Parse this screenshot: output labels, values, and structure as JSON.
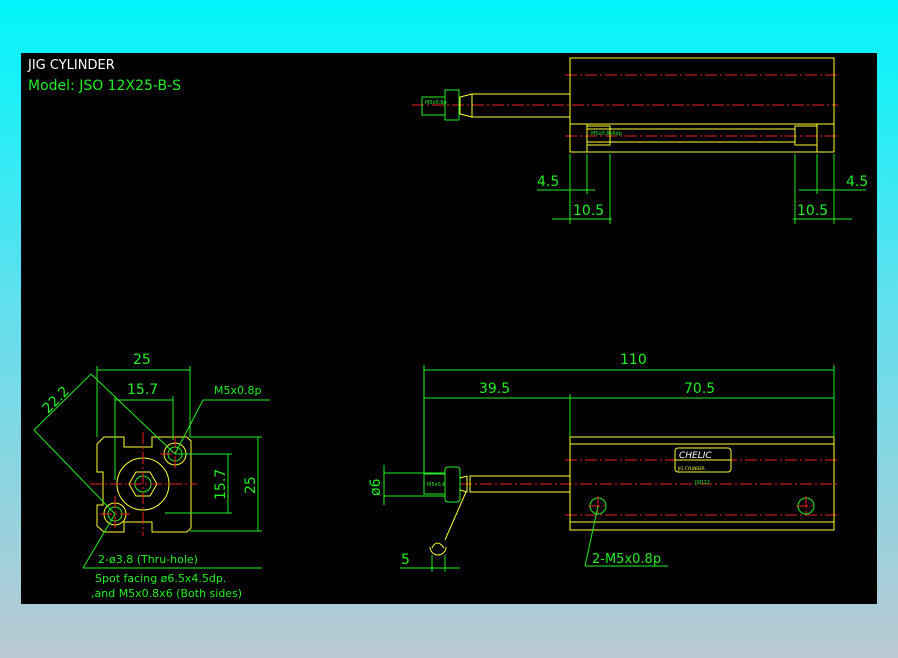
{
  "title": {
    "line1": "JIG CYLINDER",
    "line2": "Model:  JSO 12X25-B-S"
  },
  "top_view": {
    "dim_left_small": "4.5",
    "dim_left_large": "10.5",
    "dim_right_small": "4.5",
    "dim_right_large": "10.5",
    "rod_thread_label": "M5x0.8p",
    "port_label": "M5x0.8x6dp"
  },
  "end_view": {
    "dim_width": "25",
    "dim_hole_pitch_h": "15.7",
    "dim_diagonal": "22.2",
    "dim_hole_pitch_v": "15.7",
    "dim_height": "25",
    "thread_label": "M5x0.8p",
    "note_line1": "2-ø3.8 (Thru-hole)",
    "note_line2": "Spot facing ø6.5x4.5dp.",
    "note_line3": ",and M5x0.8x6 (Both sides)"
  },
  "side_view": {
    "dim_total": "110",
    "dim_rod": "39.5",
    "dim_body": "70.5",
    "dim_rod_dia": "ø6",
    "dim_wrench": "5",
    "port_label": "2-M5x0.8p",
    "nameplate_brand": "CHELIC",
    "nameplate_line": "JIG CYLINDER",
    "model_mark": "JSO12",
    "rod_thread_label": "M5x0.8"
  },
  "colors": {
    "background": "#000000",
    "outline": "#ffff33",
    "dimension": "#22ee22",
    "centerline": "#ee2020",
    "title": "#ffffff"
  }
}
